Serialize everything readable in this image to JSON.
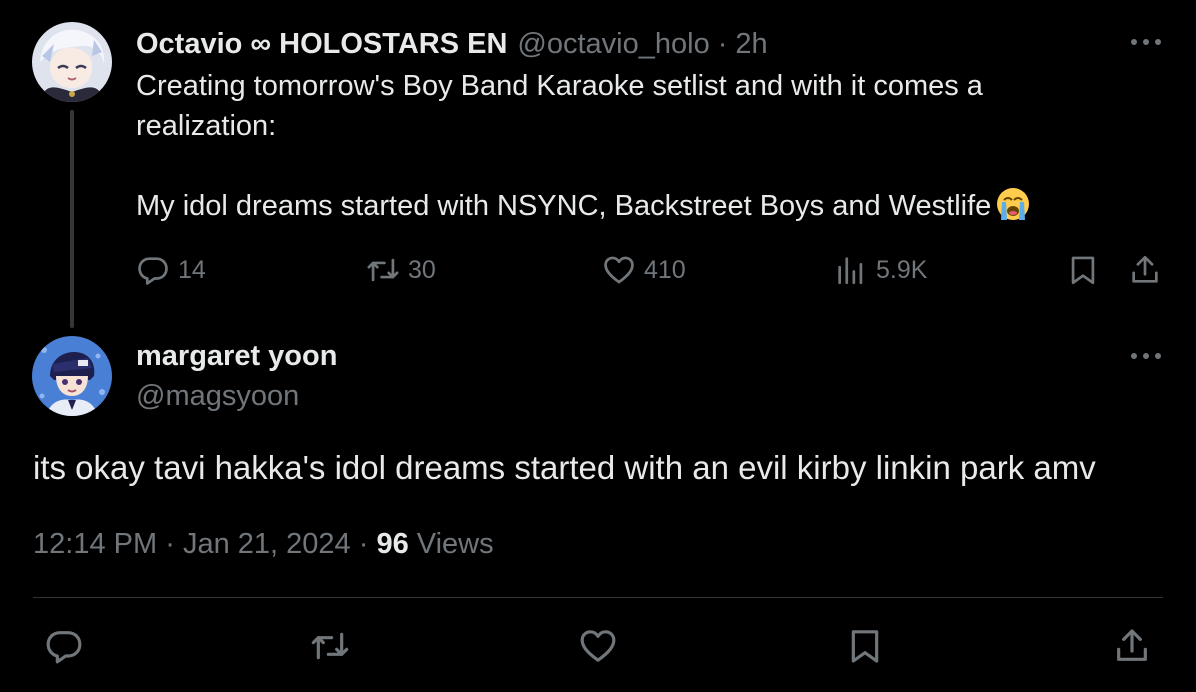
{
  "colors": {
    "background": "#000000",
    "primary_text": "#e7e9ea",
    "secondary_text": "#71767b",
    "divider": "#2f3336",
    "thread_line": "#333639"
  },
  "parent_tweet": {
    "author_name": "Octavio ∞ HOLOSTARS EN",
    "author_handle": "@octavio_holo",
    "separator": "·",
    "time_ago": "2h",
    "text": "Creating tomorrow's Boy Band Karaoke setlist and with it comes a\nrealization:\n\nMy idol dreams started with NSYNC, Backstreet Boys and Westlife",
    "emoji_icon": "loudly-crying-face-icon",
    "actions": {
      "replies": "14",
      "reposts": "30",
      "likes": "410",
      "views": "5.9K"
    },
    "icons": [
      "reply-icon",
      "repost-icon",
      "like-icon",
      "views-icon",
      "bookmark-icon",
      "share-icon",
      "more-icon"
    ]
  },
  "reply_tweet": {
    "author_name": "margaret yoon",
    "author_handle": "@magsyoon",
    "text": "its okay tavi hakka's idol dreams started with an evil kirby linkin park amv",
    "time": "12:14 PM",
    "separator": "·",
    "date": "Jan 21, 2024",
    "views_count": "96",
    "views_label": "Views",
    "icons": [
      "reply-icon",
      "repost-icon",
      "like-icon",
      "bookmark-icon",
      "share-icon",
      "more-icon"
    ]
  }
}
